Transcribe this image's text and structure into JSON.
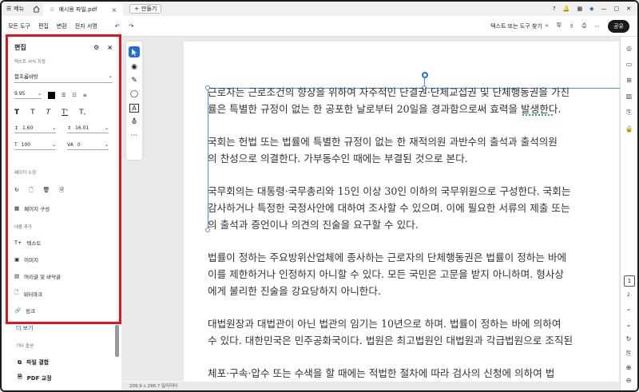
{
  "titlebar": {
    "menu_label": "메뉴",
    "tab_title": "예시용 파일.pdf",
    "new_tab_label": "만들기"
  },
  "toolbar": {
    "menu_items": [
      "모든 도구",
      "편집",
      "변환",
      "전자 서명"
    ],
    "search_placeholder": "텍스트 또는 도구 찾기",
    "share_label": "공유"
  },
  "edit_panel": {
    "title": "편집",
    "format_section": "텍스트 서식 지정",
    "font_name": "함초롬바탕",
    "font_size": "9.95",
    "style_buttons": [
      "T",
      "T",
      "T",
      "T'",
      "T,"
    ],
    "line_spacing": "1.60",
    "paragraph_spacing": "16.01",
    "horizontal_scale": "100",
    "char_spacing": "0",
    "page_section": "페이지 수정",
    "page_composition": "페이지 구성",
    "add_section": "내용 추가",
    "add_items": [
      "텍스트",
      "이미지",
      "머리글 및 바닥글",
      "워터마크",
      "링크"
    ]
  },
  "left_column": {
    "more_label": "더 보기",
    "other_section": "기타 옵션",
    "other_items": [
      "파일 결합",
      "PDF 교정"
    ]
  },
  "document": {
    "paragraphs": [
      [
        "근로자는 근로조건의 향상을 위하여 자주적인 단결권·단체교섭권 및 단체행동권을 가진",
        "률은 특별한 규정이 없는 한 공포한 날로부터 20일을 경과함으로써 효력을 발생한다."
      ],
      [
        "국회는 헌법 또는 법률에 특별한 규정이 없는 한 재적의원 과반수의 출석과 출석의원",
        "의 찬성으로 의결한다. 가부동수인 때에는 부결된 것으로 본다."
      ],
      [
        "국무회의는 대통령·국무총리와 15인 이상 30인 이하의 국무위원으로 구성한다. 국회는",
        "감사하거나 특정한 국정사안에 대하여 조사할 수 있으며. 이에 필요한 서류의 제출 또는",
        "의 출석과 증언이나 의견의 진술을 요구할 수 있다."
      ],
      [
        "법률이 정하는 주요방위산업체에 종사하는 근로자의 단체행동권은 법률이 정하는 바에",
        "이를 제한하거나 인정하지 아니할 수 있다. 모든 국민은 고문을 받지 아니하며. 형사상",
        "에게 불리한 진술을 강요당하지 아니한다."
      ],
      [
        "대법원장과 대법관이 아닌 법관의 임기는 10년으로 하며. 법률이 정하는 바에 의하여",
        "수 있다. 대한민국은 민주공화국이다. 법원은 최고법원인 대법원과 각급법원으로 조직된"
      ],
      [
        "체포·구속·압수 또는 수색을 할 때에는 적법한 절차에 따라 검사의 신청에 의하여 법"
      ]
    ]
  },
  "pagination": {
    "current": "1",
    "next": "2"
  },
  "status": {
    "page_size": "209.9 x 296.7 밀리미터"
  },
  "colors": {
    "highlight": "#e3131a",
    "accent": "#1f6fde"
  }
}
